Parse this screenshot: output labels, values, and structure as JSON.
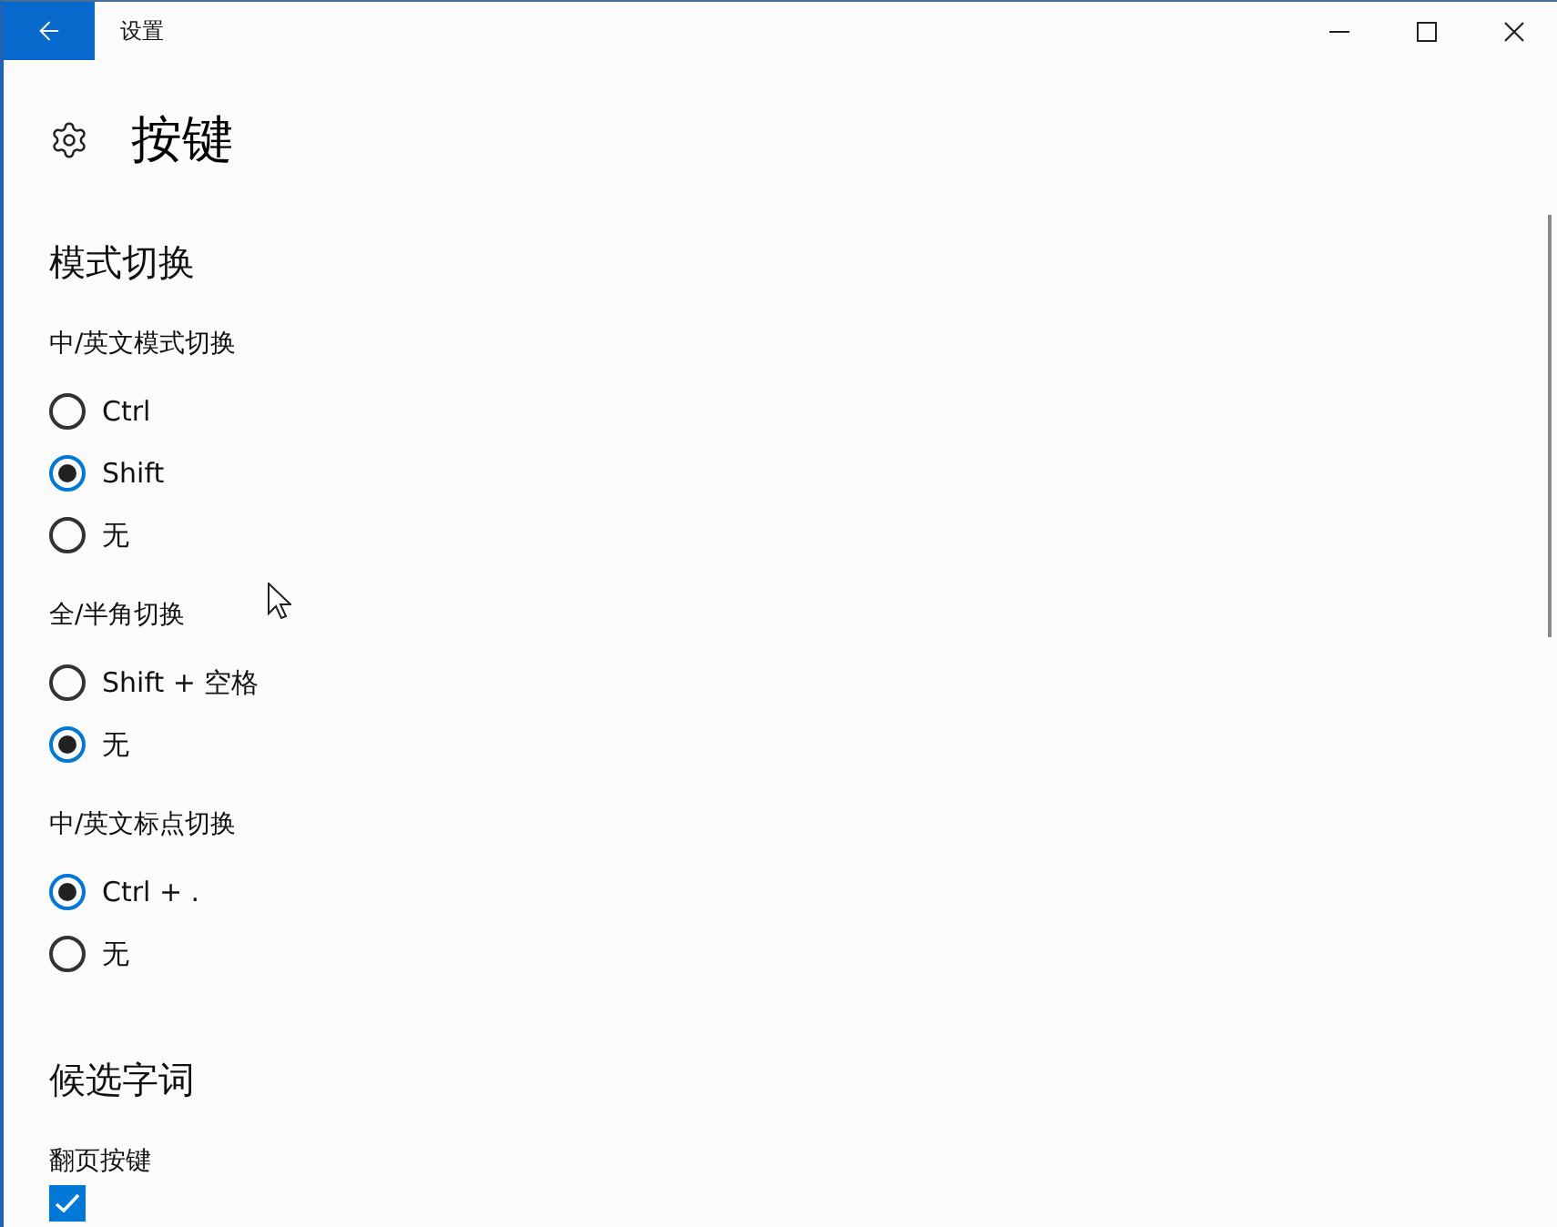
{
  "window": {
    "title": "设置"
  },
  "page": {
    "title": "按键"
  },
  "sections": [
    {
      "heading": "模式切换",
      "groups": [
        {
          "label": "中/英文模式切换",
          "kind": "radio",
          "options": [
            {
              "label": "Ctrl",
              "selected": false
            },
            {
              "label": "Shift",
              "selected": true
            },
            {
              "label": "无",
              "selected": false
            }
          ]
        },
        {
          "label": "全/半角切换",
          "kind": "radio",
          "options": [
            {
              "label": "Shift + 空格",
              "selected": false
            },
            {
              "label": "无",
              "selected": true
            }
          ]
        },
        {
          "label": "中/英文标点切换",
          "kind": "radio",
          "options": [
            {
              "label": "Ctrl + .",
              "selected": true
            },
            {
              "label": "无",
              "selected": false
            }
          ]
        }
      ]
    },
    {
      "heading": "候选字词",
      "groups": [
        {
          "label": "翻页按键",
          "kind": "checkbox",
          "options": [
            {
              "checked": true
            }
          ]
        }
      ]
    }
  ]
}
